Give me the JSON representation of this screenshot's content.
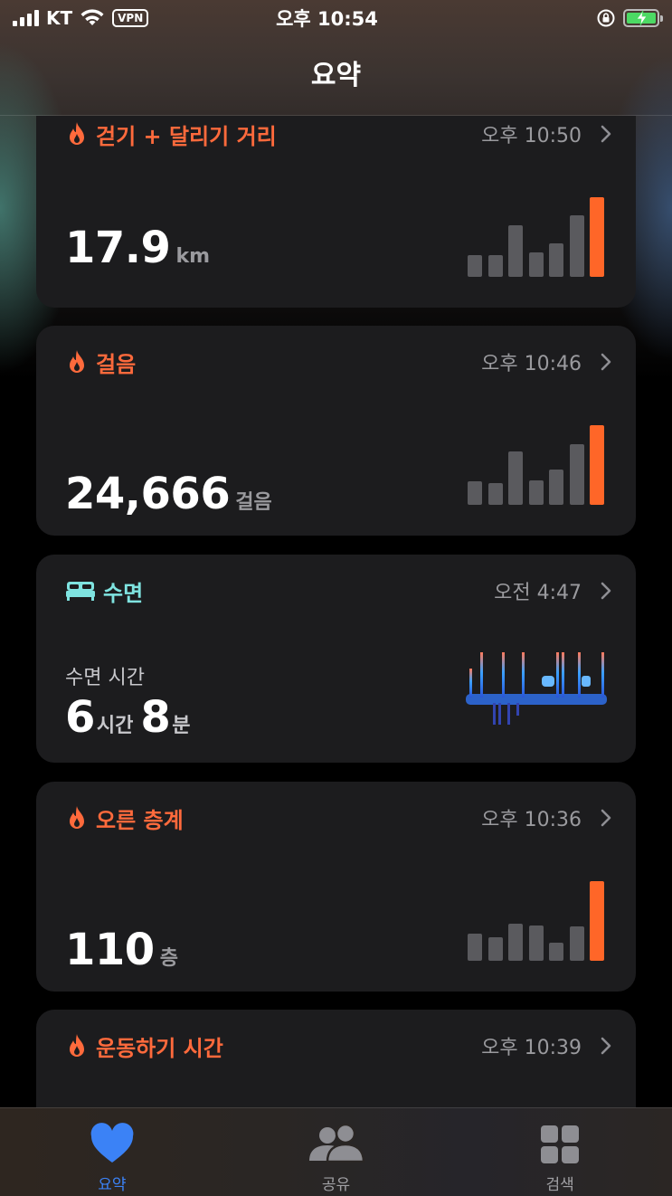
{
  "status_bar": {
    "carrier": "KT",
    "vpn": "VPN",
    "time": "오후 10:54"
  },
  "nav": {
    "title": "요약"
  },
  "cards": [
    {
      "title": "걷기 + 달리기 거리",
      "time": "오후 10:50",
      "value": "17.9",
      "unit": "km",
      "bar_levels": [
        0.27,
        0.27,
        0.65,
        0.31,
        0.42,
        0.77,
        1.0
      ]
    },
    {
      "title": "걸음",
      "time": "오후 10:46",
      "value": "24,666",
      "unit": "걸음",
      "bar_levels": [
        0.29,
        0.27,
        0.67,
        0.31,
        0.44,
        0.76,
        1.0
      ]
    },
    {
      "title": "수면",
      "time": "오전 4:47",
      "label": "수면 시간",
      "hours": "6",
      "hours_unit": "시간",
      "minutes": "8",
      "minutes_unit": "분"
    },
    {
      "title": "오른 층계",
      "time": "오후 10:36",
      "value": "110",
      "unit": "층",
      "bar_levels": [
        0.34,
        0.3,
        0.47,
        0.44,
        0.23,
        0.43,
        1.0
      ]
    },
    {
      "title": "운동하기 시간",
      "time": "오후 10:39"
    }
  ],
  "colors": {
    "accent_orange": "#ff6a3c",
    "sleep_cyan": "#7fe3e0",
    "tab_active": "#3b82f6"
  },
  "icons": {
    "activity": "flame-icon",
    "sleep": "bed-icon",
    "chevron": "chevron-right-icon"
  },
  "tabs": [
    {
      "label": "요약",
      "icon": "heart-icon",
      "active": true
    },
    {
      "label": "공유",
      "icon": "people-icon",
      "active": false
    },
    {
      "label": "검색",
      "icon": "grid-icon",
      "active": false
    }
  ]
}
